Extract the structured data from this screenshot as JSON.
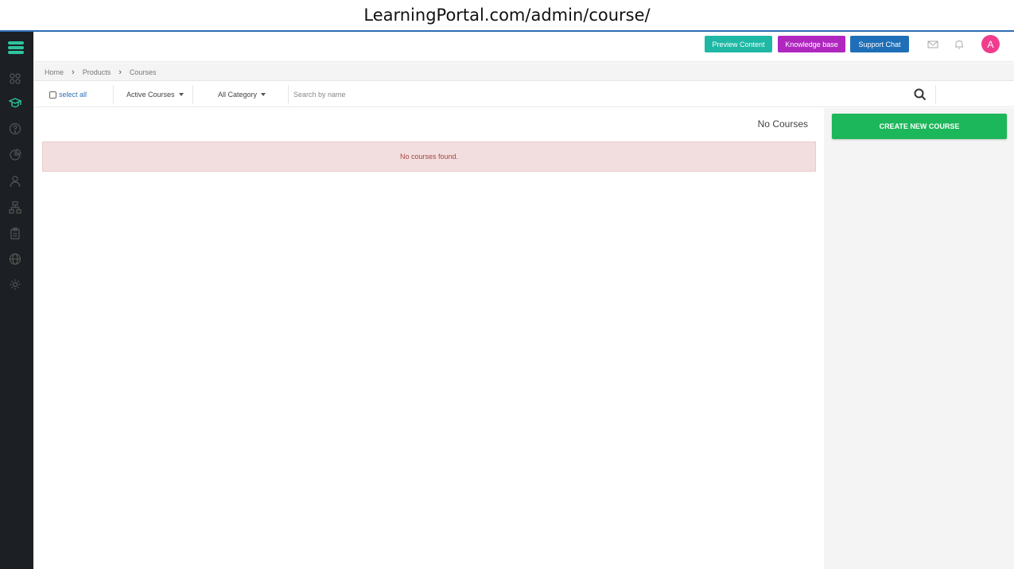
{
  "browser": {
    "url": "LearningPortal.com/admin/course/"
  },
  "sidebar": {
    "logo": "stack-logo-icon",
    "items": [
      {
        "icon": "dashboard-icon",
        "active": false
      },
      {
        "icon": "graduation-cap-icon",
        "active": true
      },
      {
        "icon": "help-circle-icon",
        "active": false
      },
      {
        "icon": "pie-chart-icon",
        "active": false
      },
      {
        "icon": "users-icon",
        "active": false
      },
      {
        "icon": "hierarchy-icon",
        "active": false
      },
      {
        "icon": "clipboard-icon",
        "active": false
      },
      {
        "icon": "globe-icon",
        "active": false
      },
      {
        "icon": "settings-gear-icon",
        "active": false
      }
    ],
    "accent": "#2ec4a0"
  },
  "header": {
    "preview_label": "Preview Content",
    "kb_label": "Knowledge base",
    "chat_label": "Support Chat",
    "avatar_initial": "A",
    "colors": {
      "preview": "#1fb8a5",
      "kb": "#b027c0",
      "chat": "#1f6fb8",
      "avatar": "#f03c8c"
    }
  },
  "breadcrumb": {
    "items": [
      "Home",
      "Products",
      "Courses"
    ]
  },
  "filters": {
    "select_all": "select all",
    "status": "Active Courses",
    "category": "All Category",
    "search_placeholder": "Search by name"
  },
  "main": {
    "count_label": "No Courses",
    "empty_message": "No courses found."
  },
  "actions": {
    "create_label": "CREATE NEW COURSE",
    "create_color": "#1cb75a"
  }
}
